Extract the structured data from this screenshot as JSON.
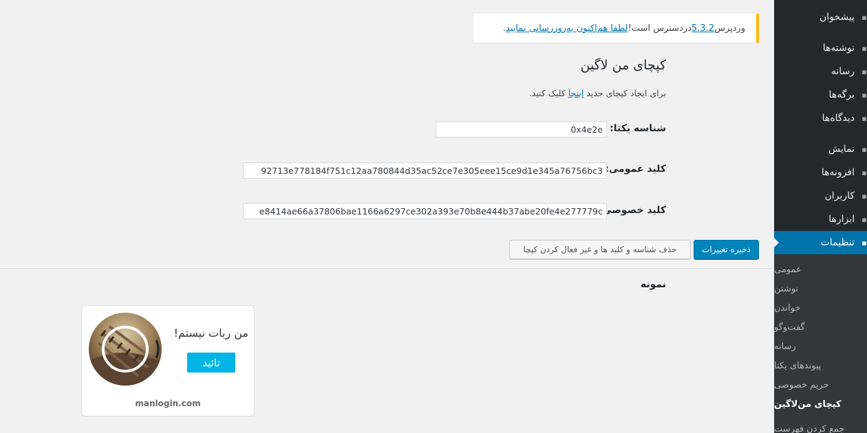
{
  "sidebar": {
    "menu": [
      {
        "label": "پیشخوان",
        "icon": "dashboard-icon"
      },
      {
        "label": "نوشته‌ها",
        "icon": "posts-icon"
      },
      {
        "label": "رسانه",
        "icon": "media-icon"
      },
      {
        "label": "برگه‌ها",
        "icon": "pages-icon"
      },
      {
        "label": "دیدگاه‌ها",
        "icon": "comments-icon"
      },
      {
        "label": "نمایش",
        "icon": "appearance-icon"
      },
      {
        "label": "افزونه‌ها",
        "icon": "plugins-icon"
      },
      {
        "label": "کاربران",
        "icon": "users-icon"
      },
      {
        "label": "ابزارها",
        "icon": "tools-icon"
      },
      {
        "label": "تنظیمات",
        "icon": "settings-icon"
      }
    ],
    "submenu": [
      {
        "label": "عمومی"
      },
      {
        "label": "نوشتن"
      },
      {
        "label": "خواندن"
      },
      {
        "label": "گفت‌وگو"
      },
      {
        "label": "رسانه"
      },
      {
        "label": "پیوندهای یکتا"
      },
      {
        "label": "حریم خصوصی"
      },
      {
        "label": "کپچای من‌لاگین"
      },
      {
        "label": "جمع کردن فهرست"
      }
    ]
  },
  "notice": {
    "prefix": "وردپرس ",
    "version_link": "5.3.2",
    "middle": " دردسترس است! ",
    "update_link": "لطفا هم‌اکنون به‌روزرسانی نمایید",
    "suffix": "."
  },
  "page": {
    "title": "کپچای من لاگین",
    "create_prefix": "برای ایجاد کپچای جدید ",
    "create_link": "اینجا",
    "create_suffix": " کلیک کنید."
  },
  "fields": {
    "unique_id": {
      "label": "شناسه یکتا:",
      "value": "0x4e2e"
    },
    "public_key": {
      "label": "کلید عمومی:",
      "value": "92713e778184f751c12aa780844d35ac52ce7e305eee15ce9d1e345a76756bc3"
    },
    "private_key": {
      "label": "کلید خصوصی:",
      "value": "e8414ae66a37806bae1166a6297ce302a393e70b8e444b37abe20fe4e277779c"
    }
  },
  "buttons": {
    "save": "ذخیره تغییرات",
    "delete": "حذف شناسه و کلید ها و غیر فعال کردن کپچا"
  },
  "sample": {
    "title": "نمونه",
    "captcha_title": "من ربات نیستم!",
    "confirm": "تائید",
    "domain": "manlogin.com"
  },
  "colors": {
    "sidebar_bg": "#23282d",
    "submenu_bg": "#32373c",
    "accent": "#0073aa",
    "primary_button": "#0085ba",
    "notice_border": "#ffb900",
    "captcha_button": "#00b4e6"
  }
}
